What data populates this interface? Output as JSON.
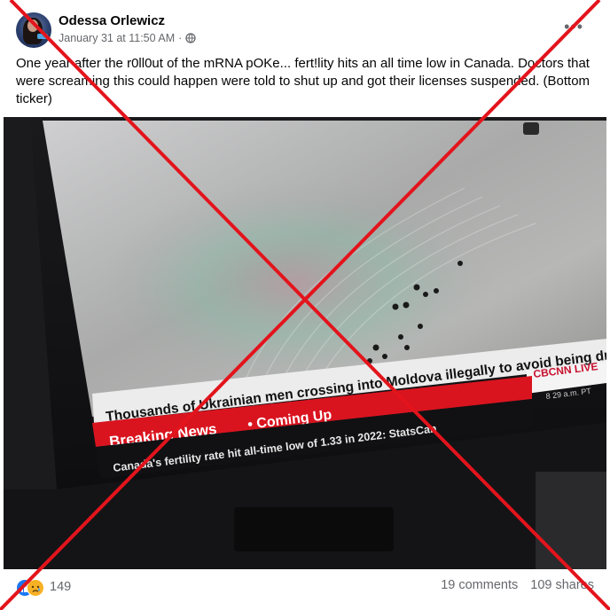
{
  "post": {
    "author": "Odessa Orlewicz",
    "timestamp": "January 31 at 11:50 AM",
    "separator": "·",
    "text": "One year after the r0ll0ut of the   mRNA pOKe... fert!lity hits an all time low in Canada. Doctors that were screaming this could happen were told to shut up and got their licenses suspended. (Bottom ticker)",
    "more_label": "•••",
    "icons": {
      "privacy": "globe-icon",
      "more": "more-options-icon"
    }
  },
  "tv": {
    "headline": "Thousands of Ukrainian men crossing into Moldova illegally to avoid being drafted",
    "logo": "CBCNN LIVE",
    "time": "8 29 a.m. PT",
    "breaking": "Breaking News",
    "coming_up": "• Coming Up",
    "ticker": "Canada's fertility rate hit all-time low of 1.33 in 2022: StatsCan"
  },
  "footer": {
    "reaction_count": "149",
    "comments": "19 comments",
    "shares": "109 shares",
    "icons": {
      "like": "like-reaction-icon",
      "sad": "sad-reaction-icon"
    }
  },
  "overlay": {
    "type": "red-x",
    "color": "#e3141c"
  }
}
